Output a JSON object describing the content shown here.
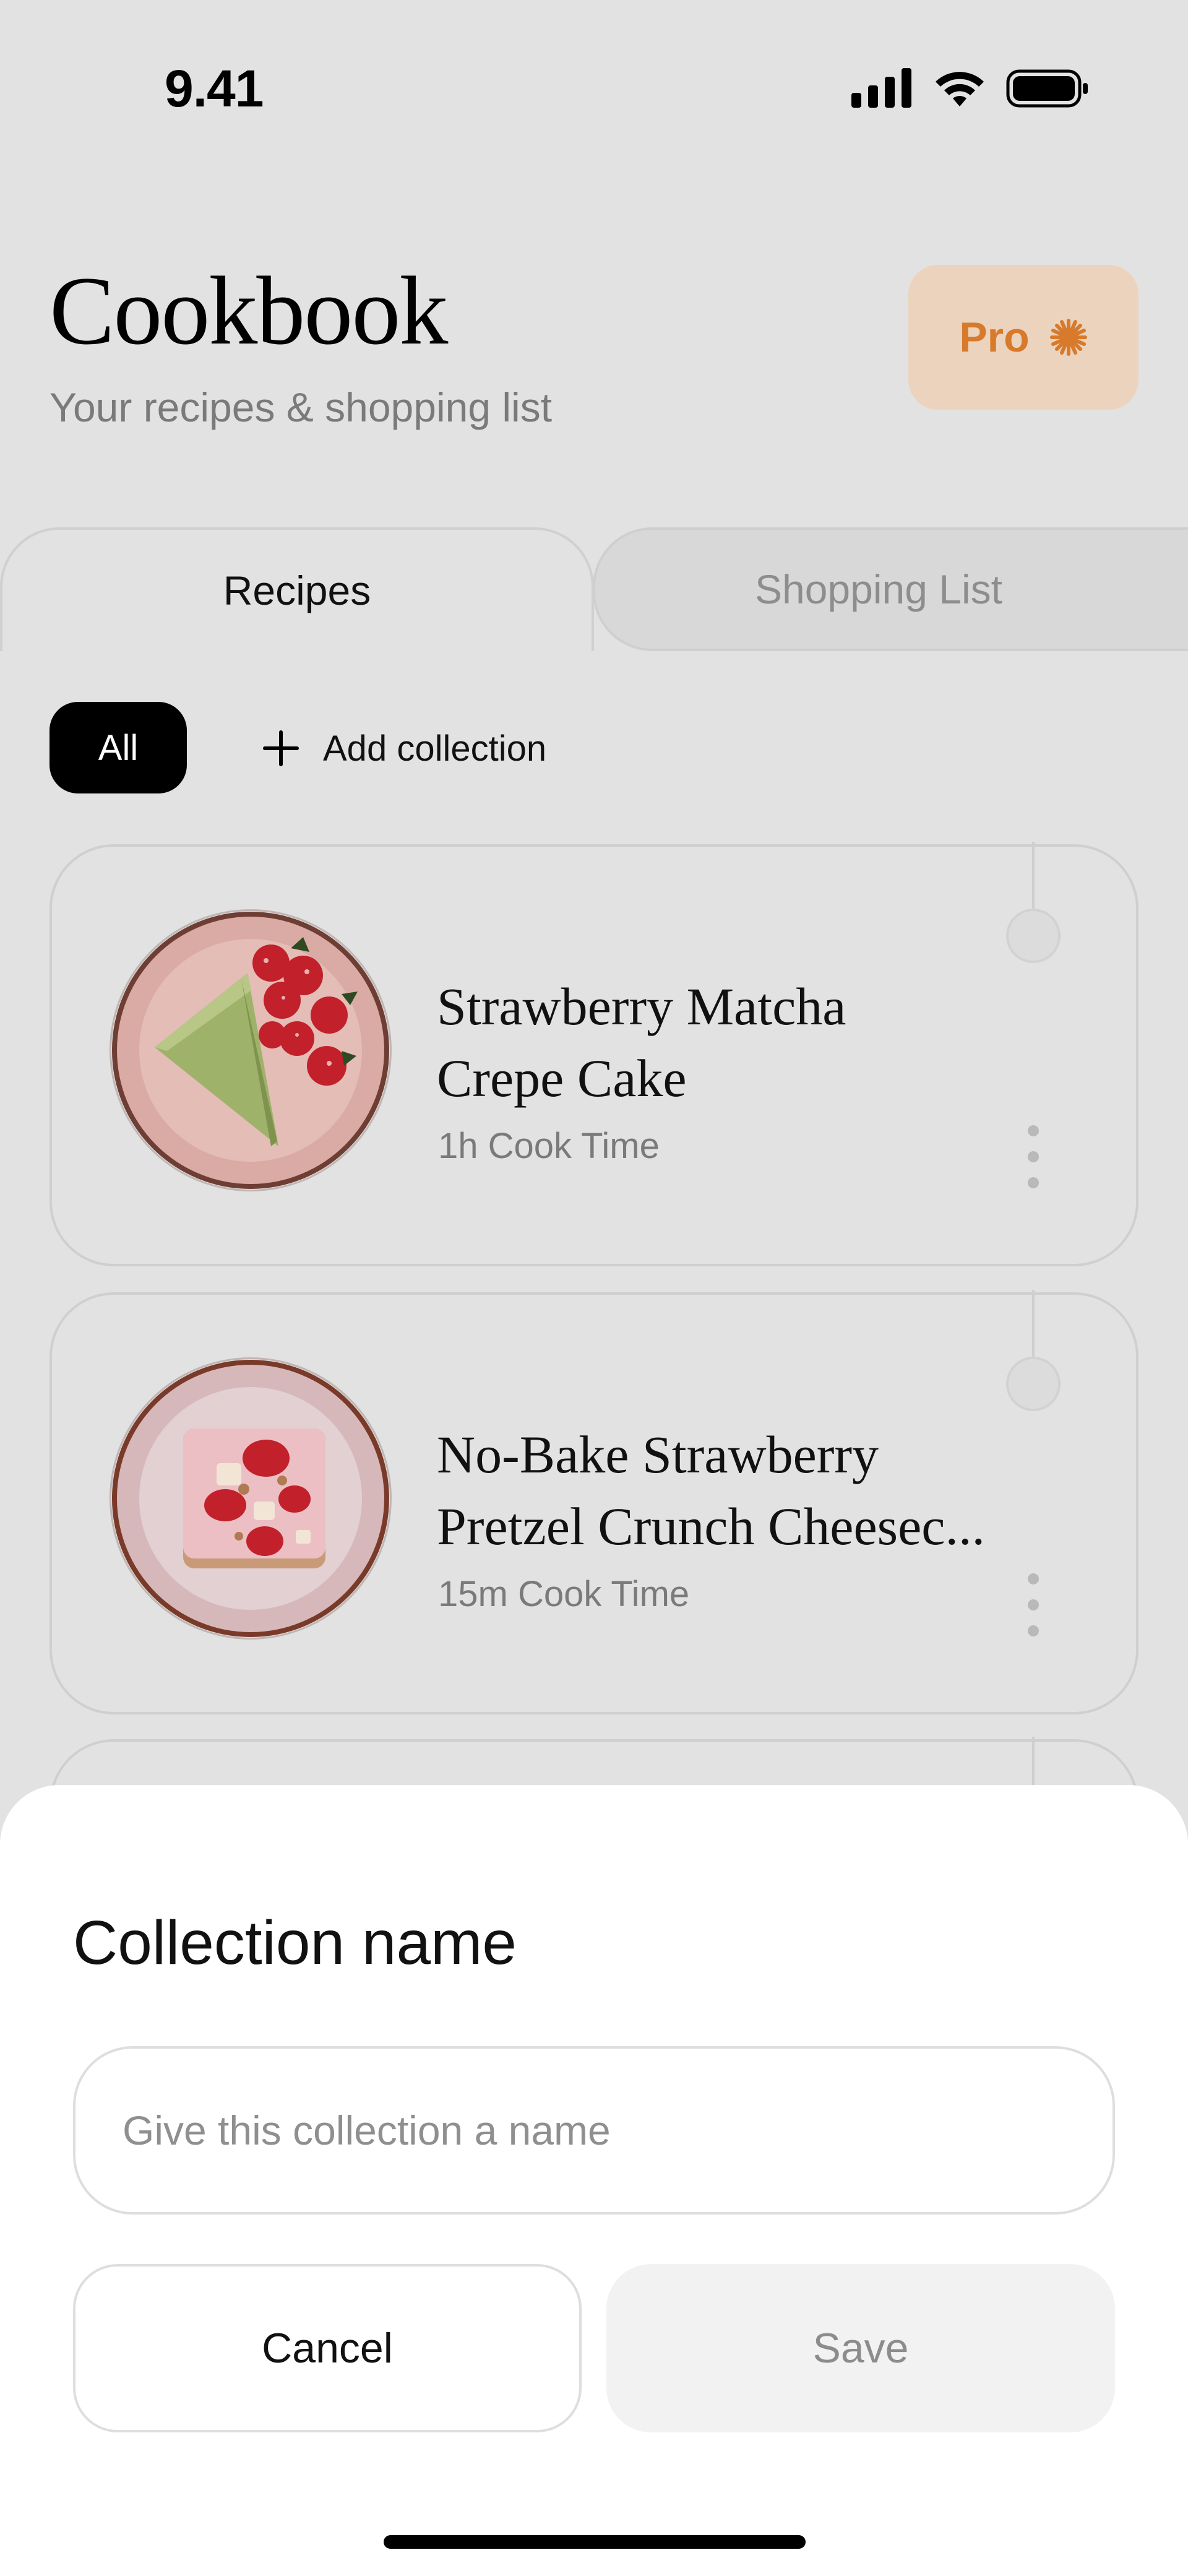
{
  "status_bar": {
    "time": "9.41"
  },
  "header": {
    "title": "Cookbook",
    "subtitle": "Your recipes & shopping list",
    "pro_label": "Pro",
    "pro_color": "#d77a2c"
  },
  "tabs": [
    {
      "label": "Recipes",
      "active": true
    },
    {
      "label": "Shopping List",
      "active": false
    }
  ],
  "filters": {
    "all_label": "All",
    "add_collection_label": "Add collection"
  },
  "recipes": [
    {
      "title_line1": "Strawberry Matcha",
      "title_line2": "Crepe Cake",
      "cook_time": "1h Cook Time",
      "image": "strawberry-matcha-crepe-cake-photo"
    },
    {
      "title_line1": "No-Bake Strawberry",
      "title_line2": "Pretzel Crunch Cheesec...",
      "cook_time": "15m Cook Time",
      "image": "strawberry-pretzel-cheesecake-photo"
    }
  ],
  "sheet": {
    "title": "Collection name",
    "input_placeholder": "Give this collection a name",
    "input_value": "",
    "cancel_label": "Cancel",
    "save_label": "Save"
  }
}
